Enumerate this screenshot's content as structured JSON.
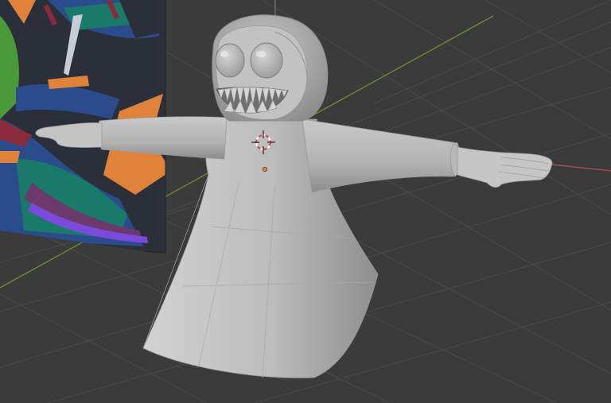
{
  "viewport": {
    "background": "#3b3b3b",
    "grid_color": "#4a4a4a",
    "x_axis_color": "#b04a4a",
    "y_axis_color": "#6f8f2e",
    "z_axis_color": "#8a8a8a"
  },
  "scene": {
    "model_color": "#bdbdbd",
    "model_shadow": "#8f8f8f",
    "origin_color": "#f08a24",
    "cursor_colors": [
      "#e04040",
      "#ffffff"
    ],
    "reference_image": {
      "palette": [
        "#2b4c8c",
        "#1a7a6a",
        "#e0823a",
        "#6b3a6a",
        "#2a2f3a",
        "#4a9a3a",
        "#8a2a3a"
      ]
    }
  },
  "icons": {
    "cursor": "3d-cursor-icon",
    "origin": "object-origin-icon"
  }
}
